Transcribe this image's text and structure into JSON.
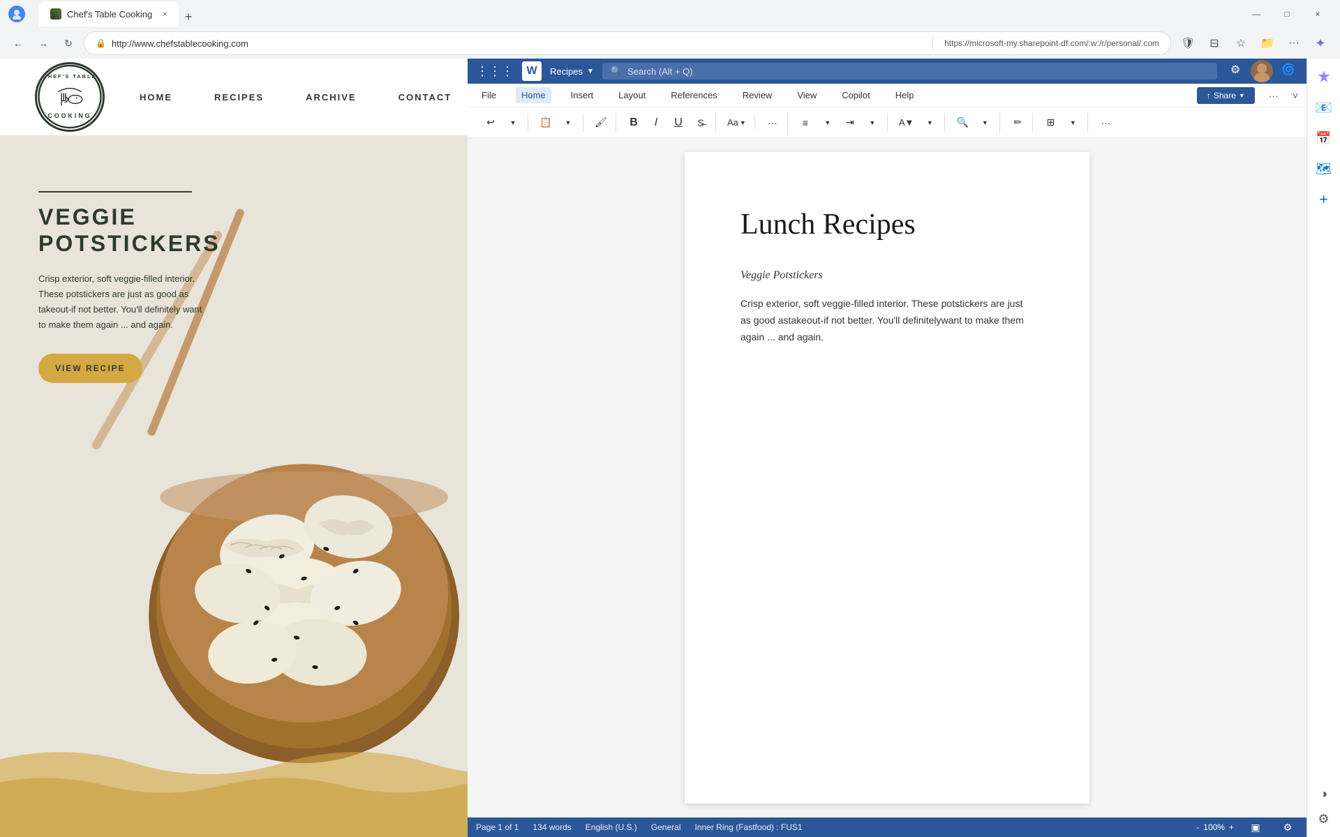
{
  "browser": {
    "tab_title": "Chef's Table Cooking",
    "url": "http://www.chefstablecooking.com",
    "url2": "https://microsoft-my.sharepoint-df.com/:w:/r/personal/.com",
    "nav_back": "←",
    "nav_forward": "→",
    "nav_refresh": "↻",
    "new_tab_label": "+",
    "close_tab": "×",
    "window_minimize": "—",
    "window_maximize": "□",
    "window_close": "×"
  },
  "website": {
    "logo_line1": "CHEF'S TABLE",
    "logo_line2": "COOKING",
    "nav_items": [
      "HOME",
      "RECIPES",
      "ARCHIVE",
      "CONTACT"
    ],
    "hero_title": "VEGGIE\nPOTSTICKERS",
    "hero_description": "Crisp exterior, soft veggie-filled interior. These potstickers are just as good as takeout-if not better. You'll definitely want to make them again ... and again.",
    "view_recipe_btn": "VIEW RECIPE"
  },
  "word": {
    "app_name": "W",
    "doc_name": "Recipes",
    "search_placeholder": "Search (Alt + Q)",
    "menu_items": [
      "File",
      "Home",
      "Insert",
      "Layout",
      "References",
      "Review",
      "View",
      "Copilot",
      "Help"
    ],
    "active_menu": "Home",
    "share_btn": "Share",
    "toolbar": {
      "undo": "↩",
      "redo": "↪",
      "paste": "📋",
      "format_painter": "🖌",
      "bold": "B",
      "italic": "I",
      "underline": "U",
      "strikethrough": "S",
      "font": "Aa",
      "more": "···"
    },
    "doc_title": "Lunch Recipes",
    "doc_subtitle": "Veggie Potstickers",
    "doc_body": "Crisp exterior, soft veggie-filled interior. These potstickers are just as good astakeout-if not better. You'll definitelywant to make them again ... and again.",
    "status": {
      "page": "Page 1 of 1",
      "words": "134 words",
      "language": "English (U.S.)",
      "general": "General",
      "ring": "Inner Ring (Fastfood) : FUS1",
      "zoom": "100%"
    }
  }
}
